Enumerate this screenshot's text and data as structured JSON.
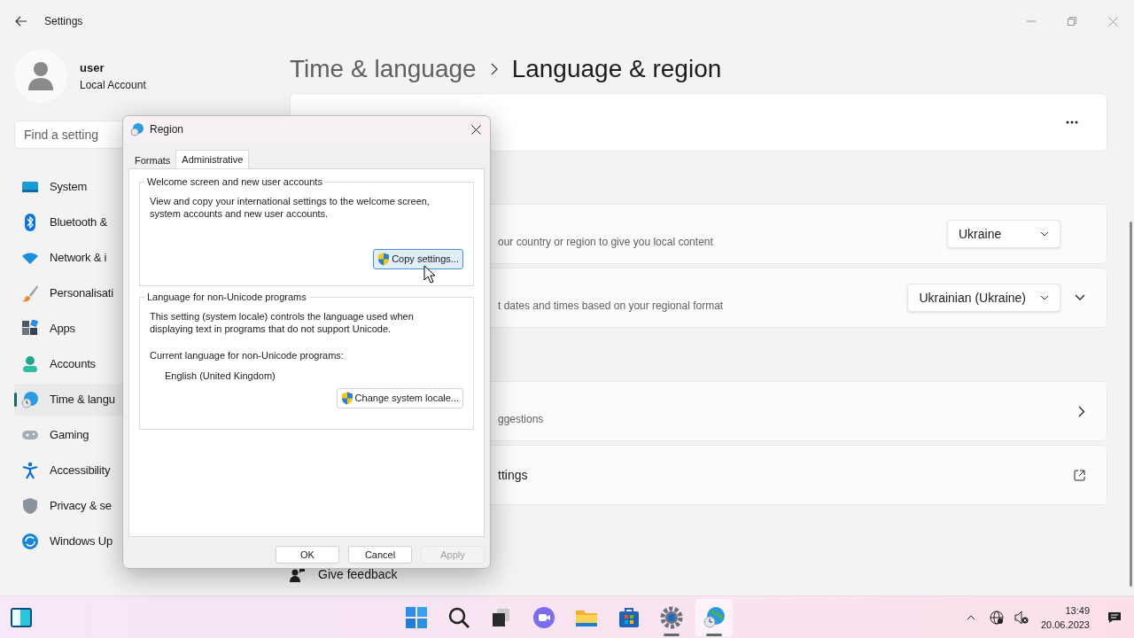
{
  "settings": {
    "title": "Settings",
    "user": {
      "name": "user",
      "account": "Local Account"
    },
    "search": {
      "placeholder": "Find a setting"
    },
    "nav": [
      {
        "kind": "system",
        "label": "System",
        "selected": false
      },
      {
        "kind": "bluetooth",
        "label": "Bluetooth &",
        "selected": false
      },
      {
        "kind": "network",
        "label": "Network & i",
        "selected": false
      },
      {
        "kind": "personalise",
        "label": "Personalisati",
        "selected": false
      },
      {
        "kind": "apps",
        "label": "Apps",
        "selected": false
      },
      {
        "kind": "accounts",
        "label": "Accounts",
        "selected": false
      },
      {
        "kind": "time",
        "label": "Time & langu",
        "selected": true
      },
      {
        "kind": "gaming",
        "label": "Gaming",
        "selected": false
      },
      {
        "kind": "accessibility",
        "label": "Accessibility",
        "selected": false
      },
      {
        "kind": "privacy",
        "label": "Privacy & se",
        "selected": false
      },
      {
        "kind": "update",
        "label": "Windows Up",
        "selected": false
      }
    ],
    "breadcrumb": {
      "parent": "Time & language",
      "current": "Language & region"
    },
    "cards": [
      {
        "kind": "more"
      },
      {
        "kind": "dropdown",
        "description": "our country or region to give you local content",
        "value": "Ukraine"
      },
      {
        "kind": "dropdown_expand",
        "description": "t dates and times based on your regional format",
        "value": "Ukrainian (Ukraine)"
      },
      {
        "kind": "chevron",
        "description": "ggestions"
      },
      {
        "kind": "external",
        "title": "ttings"
      }
    ],
    "feedback": "Give feedback"
  },
  "dialog": {
    "title": "Region",
    "tabs": [
      {
        "label": "Formats",
        "selected": false
      },
      {
        "label": "Administrative",
        "selected": true
      }
    ],
    "groups": [
      {
        "title": "Welcome screen and new user accounts",
        "text": "View and copy your international settings to the welcome screen, system accounts and new user accounts.",
        "button": "Copy settings..."
      },
      {
        "title": "Language for non-Unicode programs",
        "text": "This setting (system locale) controls the language used when displaying text in programs that do not support Unicode.",
        "label": "Current language for non-Unicode programs:",
        "value": "English (United Kingdom)",
        "button": "Change system locale..."
      }
    ],
    "buttons": [
      {
        "label": "OK",
        "disabled": false
      },
      {
        "label": "Cancel",
        "disabled": false
      },
      {
        "label": "Apply",
        "disabled": true
      }
    ]
  },
  "taskbar": {
    "apps": [
      {
        "kind": "start",
        "running": false
      },
      {
        "kind": "search",
        "running": false
      },
      {
        "kind": "taskview",
        "running": false
      },
      {
        "kind": "chat",
        "running": false
      },
      {
        "kind": "explorer",
        "running": false
      },
      {
        "kind": "store",
        "running": false
      },
      {
        "kind": "settings",
        "running": true
      },
      {
        "kind": "region",
        "running": true
      }
    ],
    "time": "13:49",
    "date": "20.06.2023"
  }
}
